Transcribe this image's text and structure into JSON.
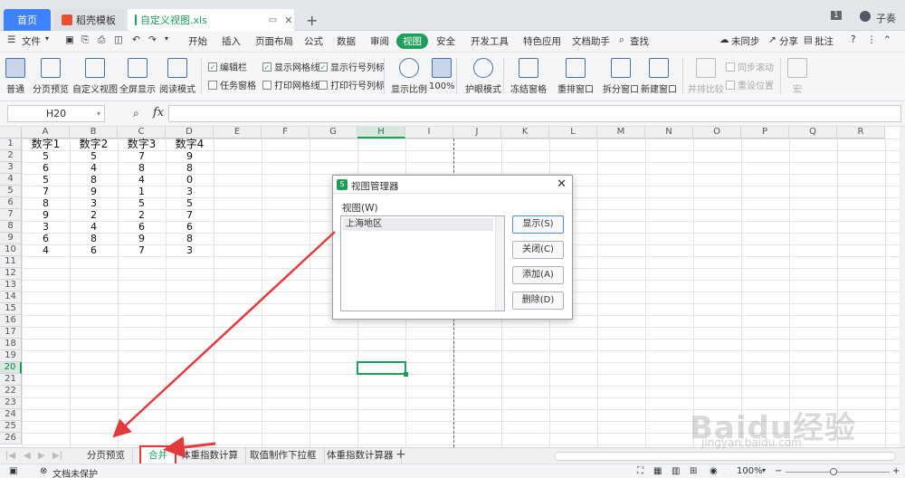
{
  "tabs": {
    "home": "首页",
    "template": "稻壳模板",
    "file": "自定义视图.xls",
    "user": "子奏"
  },
  "menu": {
    "file": "文件",
    "items": [
      "开始",
      "插入",
      "页面布局",
      "公式",
      "数据",
      "审阅",
      "视图",
      "安全",
      "开发工具",
      "特色应用",
      "文档助手"
    ],
    "search": "查找",
    "sync": "未同步",
    "share": "分享",
    "annotate": "批注"
  },
  "ribbon": {
    "normal": "普通",
    "page_preview": "分页预览",
    "custom_view": "自定义视图",
    "fullscreen": "全屏显示",
    "read_mode": "阅读模式",
    "edit_bar": "编辑栏",
    "show_grid": "显示网格线",
    "show_rowcol": "显示行号列标",
    "task_pane": "任务窗格",
    "print_grid": "打印网格线",
    "print_rowcol": "打印行号列标",
    "zoom": "显示比例",
    "zoom100": "100%",
    "eye_mode": "护眼模式",
    "freeze": "冻结窗格",
    "rearrange": "重排窗口",
    "split": "拆分窗口",
    "new_window": "新建窗口",
    "side_by_side": "并排比较",
    "sync_scroll": "同步滚动",
    "reset_pos": "重设位置",
    "macro": "宏"
  },
  "formula": {
    "cell_ref": "H20",
    "fx": "fx"
  },
  "columns": [
    "A",
    "B",
    "C",
    "D",
    "E",
    "F",
    "G",
    "H",
    "I",
    "J",
    "K",
    "L",
    "M",
    "N",
    "O",
    "P",
    "Q",
    "R"
  ],
  "rows": [
    "1",
    "2",
    "3",
    "4",
    "5",
    "6",
    "7",
    "8",
    "9",
    "10",
    "11",
    "12",
    "13",
    "14",
    "15",
    "16",
    "17",
    "18",
    "19",
    "20",
    "21",
    "22",
    "23",
    "24",
    "25",
    "26"
  ],
  "table": {
    "header": [
      "数字1",
      "数字2",
      "数字3",
      "数字4"
    ],
    "data": [
      [
        "5",
        "5",
        "7",
        "9"
      ],
      [
        "6",
        "4",
        "8",
        "8"
      ],
      [
        "5",
        "8",
        "4",
        "0"
      ],
      [
        "7",
        "9",
        "1",
        "3"
      ],
      [
        "8",
        "3",
        "5",
        "5"
      ],
      [
        "9",
        "2",
        "2",
        "7"
      ],
      [
        "3",
        "4",
        "6",
        "6"
      ],
      [
        "6",
        "8",
        "9",
        "8"
      ],
      [
        "4",
        "6",
        "7",
        "3"
      ]
    ]
  },
  "dialog": {
    "title": "视图管理器",
    "list_label": "视图(W)",
    "views": [
      "上海地区"
    ],
    "show": "显示(S)",
    "close": "关闭(C)",
    "add": "添加(A)",
    "delete": "删除(D)"
  },
  "sheets": [
    "分页预览",
    "合并",
    "体重指数计算",
    "取值制作下拉框",
    "体重指数计算器"
  ],
  "status": {
    "protect": "文档未保护",
    "zoom": "100%"
  },
  "watermark": {
    "brand": "Baidu经验",
    "url": "jingyan.baidu.com"
  },
  "colors": {
    "accent": "#1e9e5a",
    "highlight": "#e23b3b",
    "home_tab": "#3d82ff"
  }
}
